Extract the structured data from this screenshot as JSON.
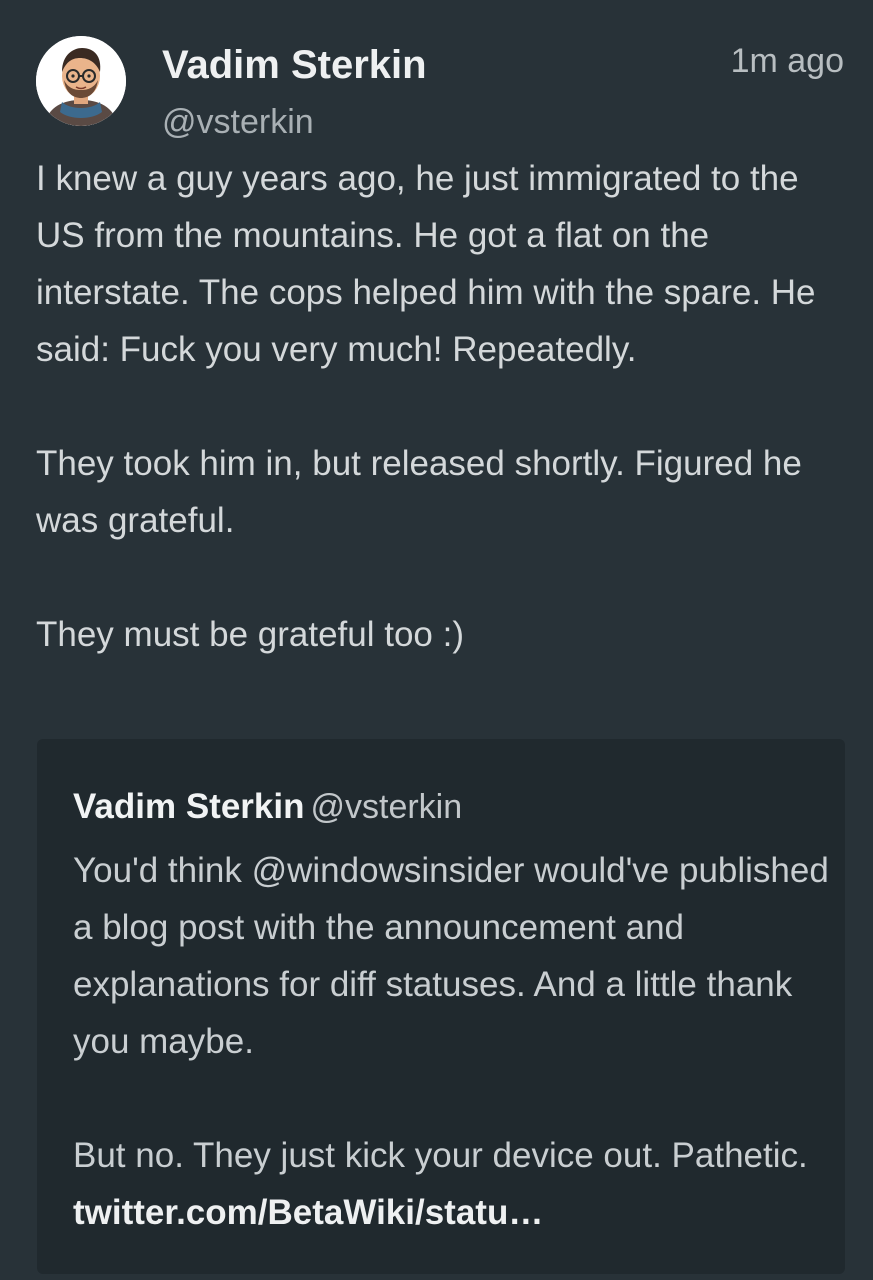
{
  "tweet": {
    "author": {
      "display_name": "Vadim Sterkin",
      "handle": "@vsterkin",
      "avatar_icon": "cartoon-avatar"
    },
    "timestamp": "1m ago",
    "paragraphs": [
      "I knew a guy years ago, he just immigrated to the US from the mountains. He got a flat on the interstate. The cops helped him with the spare. He said: Fuck you very much! Repeatedly.",
      "They took him in, but released shortly. Figured he was grateful.",
      "They must be grateful too :)"
    ]
  },
  "quoted_tweet": {
    "display_name": "Vadim Sterkin",
    "handle": "@vsterkin",
    "paragraph_1": "You'd think @windowsinsider would've published a blog post with the announcement and explanations for diff statuses. And a little thank you maybe.",
    "paragraph_2_text": "But no. They just kick your device out. Pathetic.",
    "link_text": "twitter.com/BetaWiki/statu…"
  },
  "colors": {
    "background": "#283238",
    "quote_background": "#20292e",
    "primary_text": "#d4d8da"
  }
}
